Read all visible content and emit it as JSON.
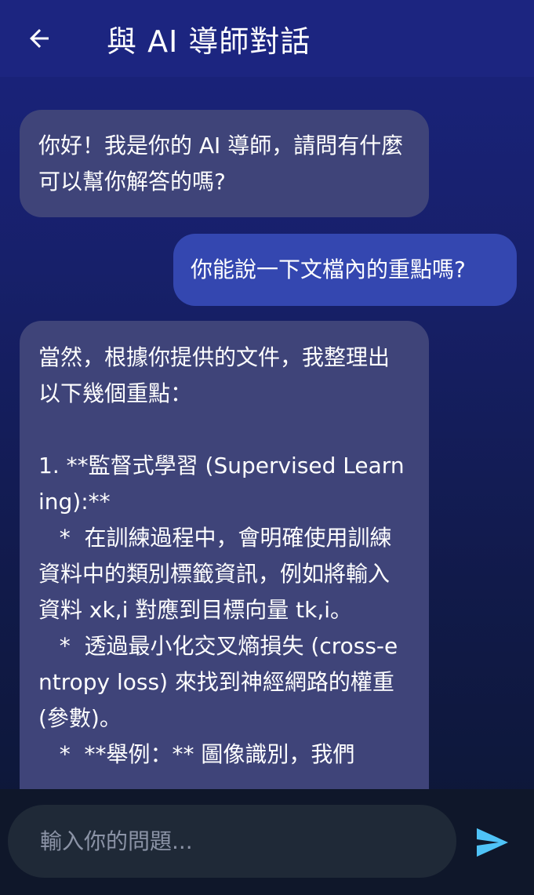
{
  "header": {
    "title": "與 AI 導師對話",
    "back_icon": "arrow-left-icon"
  },
  "messages": [
    {
      "role": "ai",
      "text": "你好！我是你的 AI 導師，請問有什麼可以幫你解答的嗎?"
    },
    {
      "role": "user",
      "text": "你能說一下文檔內的重點嗎?"
    },
    {
      "role": "ai",
      "text": "當然，根據你提供的文件，我整理出以下幾個重點：\n\n1. **監督式學習 (Supervised Learning):**\n   *  在訓練過程中，會明確使用訓練資料中的類別標籤資訊，例如將輸入資料 xk,i 對應到目標向量 tk,i。\n   *  透過最小化交叉熵損失 (cross-entropy loss) 來找到神經網路的權重 (參數)。\n   *  **舉例：** 圖像識別，我們"
    }
  ],
  "composer": {
    "placeholder": "輸入你的問題...",
    "value": "",
    "send_icon": "send-icon"
  },
  "colors": {
    "app_bar": "#1c2580",
    "ai_bubble": "#3f4479",
    "user_bubble": "#3447b0",
    "input_bg": "#1f2937",
    "send_accent": "#4fc3f7"
  }
}
